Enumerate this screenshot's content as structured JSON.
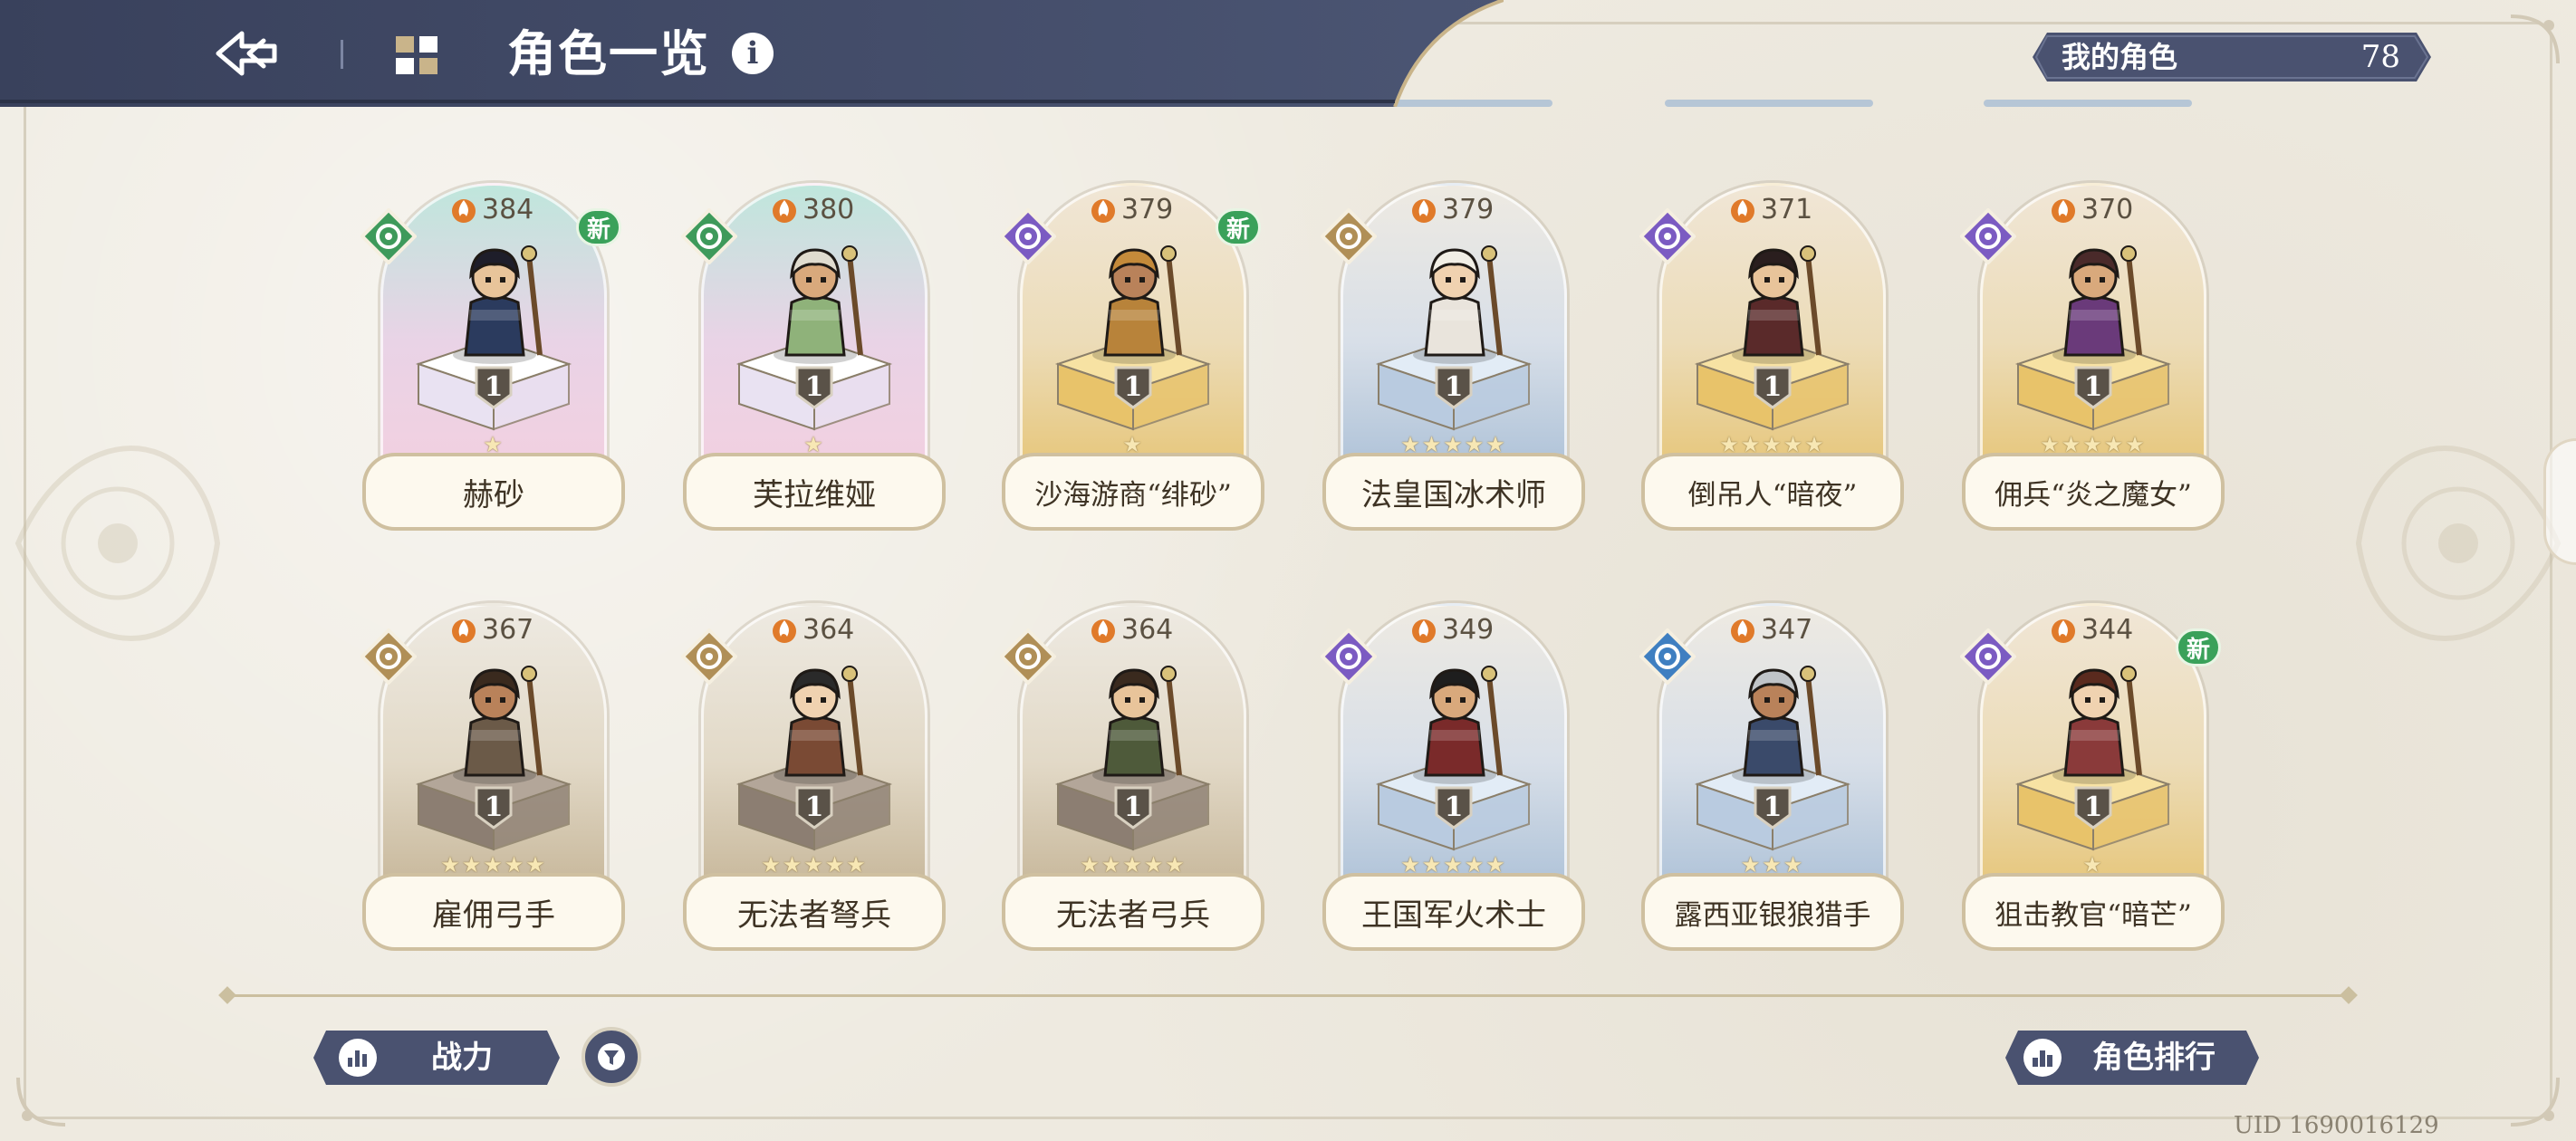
{
  "header": {
    "title": "角色一览",
    "info_icon": "info-icon",
    "back_icon": "back-arrow-icon",
    "grid_icon": "grid-menu-icon",
    "colors": {
      "header_bg": "#414a66",
      "accent": "#d9b874"
    }
  },
  "owned": {
    "label": "我的角色",
    "count": "78"
  },
  "characters": [
    {
      "name": "赫砂",
      "power": "384",
      "level": "1",
      "stars": "★",
      "element": "green",
      "is_new": true,
      "new_label": "新"
    },
    {
      "name": "芙拉维娅",
      "power": "380",
      "level": "1",
      "stars": "★",
      "element": "green",
      "is_new": false,
      "new_label": ""
    },
    {
      "name": "沙海游商“绯砂”",
      "power": "379",
      "level": "1",
      "stars": "★",
      "element": "purple",
      "is_new": true,
      "new_label": "新"
    },
    {
      "name": "法皇国冰术师",
      "power": "379",
      "level": "1",
      "stars": "★★★★★",
      "element": "gold",
      "is_new": false,
      "new_label": ""
    },
    {
      "name": "倒吊人“暗夜”",
      "power": "371",
      "level": "1",
      "stars": "★★★★★",
      "element": "purple",
      "is_new": false,
      "new_label": ""
    },
    {
      "name": "佣兵“炎之魔女”",
      "power": "370",
      "level": "1",
      "stars": "★★★★★",
      "element": "purple",
      "is_new": false,
      "new_label": ""
    },
    {
      "name": "雇佣弓手",
      "power": "367",
      "level": "1",
      "stars": "★★★★★",
      "element": "gold",
      "is_new": false,
      "new_label": ""
    },
    {
      "name": "无法者弩兵",
      "power": "364",
      "level": "1",
      "stars": "★★★★★",
      "element": "gold",
      "is_new": false,
      "new_label": ""
    },
    {
      "name": "无法者弓兵",
      "power": "364",
      "level": "1",
      "stars": "★★★★★",
      "element": "gold",
      "is_new": false,
      "new_label": ""
    },
    {
      "name": "王国军火术士",
      "power": "349",
      "level": "1",
      "stars": "★★★★★",
      "element": "purple",
      "is_new": false,
      "new_label": ""
    },
    {
      "name": "露西亚银狼猎手",
      "power": "347",
      "level": "1",
      "stars": "★★★",
      "element": "blue",
      "is_new": false,
      "new_label": ""
    },
    {
      "name": "狙击教官“暗芒”",
      "power": "344",
      "level": "1",
      "stars": "★",
      "element": "purple",
      "is_new": true,
      "new_label": "新"
    }
  ],
  "bottom": {
    "sort_label": "战力",
    "sort_icon": "bar-chart-icon",
    "filter_icon": "filter-icon",
    "rank_label": "角色排行",
    "rank_icon": "ranking-icon",
    "uid": "UID 1690016129"
  }
}
